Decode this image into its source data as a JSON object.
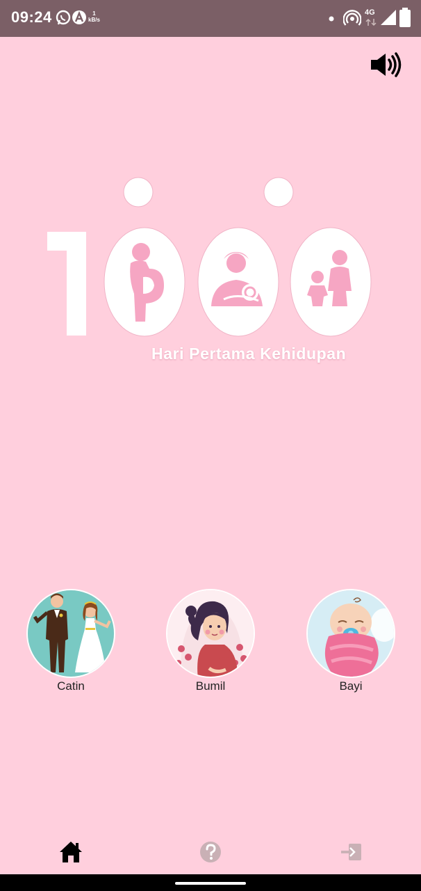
{
  "status_bar": {
    "time": "09:24",
    "speed_value": "1",
    "speed_unit": "kB/s",
    "network": "4G",
    "icons_left": [
      "whatsapp-icon",
      "a-app-icon"
    ],
    "icons_right": [
      "dot-icon",
      "hotspot-icon",
      "signal-icon",
      "battery-icon"
    ]
  },
  "header": {
    "speaker_icon": "volume-high-icon"
  },
  "logo": {
    "number_text": "1000",
    "subtitle": "Hari Pertama Kehidupan"
  },
  "categories": [
    {
      "label": "Catin",
      "icon": "couple-illustration"
    },
    {
      "label": "Bumil",
      "icon": "pregnant-woman-illustration"
    },
    {
      "label": "Bayi",
      "icon": "baby-illustration"
    }
  ],
  "bottom_nav": {
    "items": [
      {
        "name": "home",
        "icon": "home-icon",
        "active": true
      },
      {
        "name": "help",
        "icon": "help-icon",
        "active": false
      },
      {
        "name": "logout",
        "icon": "logout-icon",
        "active": false
      }
    ]
  },
  "colors": {
    "background": "#ffcfdd",
    "status_bar": "#7b5f66",
    "logo_pink": "#f6a6c3",
    "nav_inactive": "#c9b0b5"
  }
}
